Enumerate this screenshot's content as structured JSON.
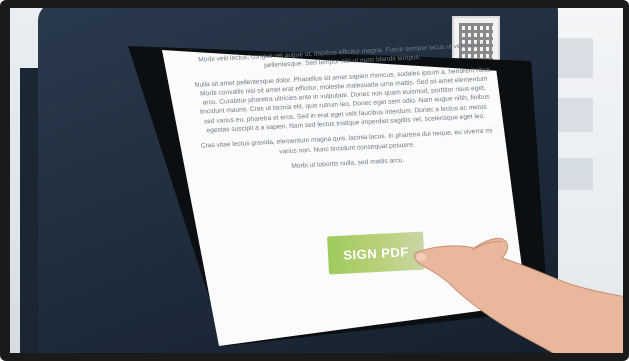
{
  "document": {
    "paragraphs": [
      "Morbi velit lectus, congue vel augue ut, dapibus efficitur magna. Fusce semper lacus ut velit lacinia pellentesque. Sed tempor nisi ut nunc blandit tempus.",
      "Nulla sit amet pellentesque dolor. Phasellus sit amet sapien rhoncus, sodales ipsum a, hendrerit risus. Morbi convallis nisi sit amet erat efficitur, molestie malesuada urna mattis. Sed sit amet elementum arcu. Curabitur pharetra ultricies ante in vulputate. Donec non quam euismod, porttitor risus eget, tincidunt mauris. Cras ut lacinia elit, quis rutrum leo. Donec eget sem odio. Nam augue nibh, finibus sed varius eu, pharetra et eros. Sed in erat eget velit faucibus interdum. Donec a lectus ac metus egestas suscipit a a sapien. Nam sed lectus tristique imperdiet sagittis vel, scelerisque eget leo.",
      "Cras vitae lectus gravida, elementum magna quis, lacinia lacus. In pharetra dui neque, eu viverra mi varius non. Nunc tincidunt consequat posuere.",
      "Morbi ut lobortis nulla, sed mattis arcu."
    ],
    "sign_button_label": "SIGN PDF"
  },
  "colors": {
    "kiosk": "#1d2a3a",
    "button_start": "#9fcb5d",
    "button_end": "#c9d6a6",
    "skin": "#e9b89c"
  },
  "icons": {
    "qr": "qr-code-icon"
  }
}
